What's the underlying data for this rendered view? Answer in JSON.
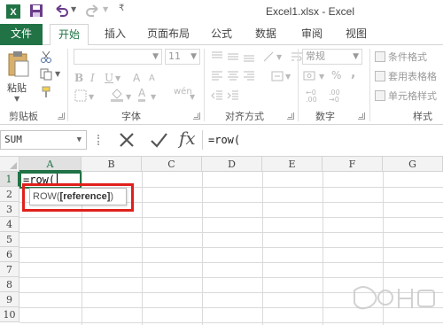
{
  "window": {
    "title": "Excel1.xlsx - Excel"
  },
  "quick_access": {
    "icons": [
      "excel-logo-icon",
      "save-icon",
      "undo-icon",
      "redo-icon",
      "customize-icon"
    ]
  },
  "tabs": [
    {
      "label": "文件"
    },
    {
      "label": "开始"
    },
    {
      "label": "插入"
    },
    {
      "label": "页面布局"
    },
    {
      "label": "公式"
    },
    {
      "label": "数据"
    },
    {
      "label": "审阅"
    },
    {
      "label": "视图"
    }
  ],
  "ribbon": {
    "paste_label": "粘贴",
    "groups": {
      "clipboard": "剪贴板",
      "font": "字体",
      "alignment": "对齐方式",
      "number": "数字",
      "styles": "样式"
    },
    "font_size": "11",
    "number_format": "常规",
    "styles_items": [
      "条件格式",
      "套用表格格",
      "单元格样式"
    ]
  },
  "formula_bar": {
    "name_box": "SUM",
    "formula": "=row("
  },
  "grid": {
    "columns": [
      "A",
      "B",
      "C",
      "D",
      "E",
      "F",
      "G"
    ],
    "rows": [
      "1",
      "2",
      "3",
      "4",
      "5",
      "6",
      "7",
      "8",
      "9",
      "10"
    ],
    "active_cell_text": "=row("
  },
  "tooltip": {
    "fn": "ROW(",
    "arg": "[reference]",
    "close": ")"
  },
  "colors": {
    "excel_green": "#217346",
    "highlight_red": "#e0201b"
  }
}
